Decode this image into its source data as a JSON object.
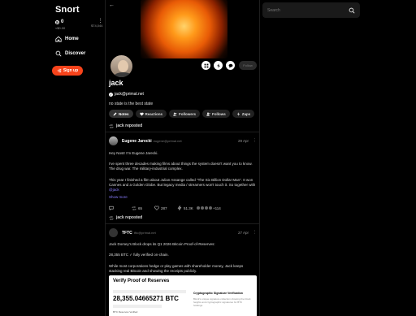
{
  "app": {
    "title": "Snort"
  },
  "sidebar": {
    "balance": {
      "value": "0",
      "sub": "≈$0.00"
    },
    "balance_right": "$74,044",
    "items": [
      {
        "label": "Home",
        "icon": "home-icon"
      },
      {
        "label": "Discover",
        "icon": "search-icon"
      }
    ],
    "signup_label": "Sign up",
    "accent": "#f7431b"
  },
  "profile": {
    "name": "jack",
    "nip05": "jack@primal.net",
    "about": "no state is the best state",
    "follow_label": "Follow",
    "tabs": [
      {
        "label": "Notes",
        "icon": "pencil-icon",
        "active": true
      },
      {
        "label": "Reactions",
        "icon": "heart-icon"
      },
      {
        "label": "Followers",
        "icon": "users-icon"
      },
      {
        "label": "Follows",
        "icon": "user-plus-icon"
      },
      {
        "label": "Zaps",
        "icon": "zap-icon"
      }
    ]
  },
  "feed": [
    {
      "repost_label": "jack reposted",
      "author": "Eugene Jarecki",
      "nip05": "eugene@primal.net",
      "date": "29 Apr",
      "text": [
        "Hey Nostr I'm Eugene Jarecki.",
        "I've spent three decades making films about things the system doesn't want you to know. The drug war. The military-industrial complex.",
        "This year I finished a film about Julian Assange called \"The Six Billion Dollar Man\". It won Cannes and a Golden Globe. But legacy media / streamers won't touch it. So together with"
      ],
      "mention": "@jack",
      "show_more": "Show more",
      "reposts": "65",
      "likes": "287",
      "zaps": "51.3K",
      "zappers_more": "+114"
    },
    {
      "repost_label": "jack reposted",
      "author": "TFTC",
      "nip05": "tftc@primal.net",
      "date": "27 Apr",
      "text": [
        "Jack Dorsey's Block drops its Q1 2026 Bitcoin Proof-of-Reserves:",
        "28,355 BTC ✓ fully verified on-chain.",
        "While most corporations hedge or play games with shareholder money, Jack keeps stacking real Bitcoin and showing the receipts publicly."
      ],
      "embed": {
        "heading": "Verify Proof of Reserves",
        "amount": "28,355.04665271 BTC",
        "right_heading": "Cryptographic Signature Verification",
        "right_text": "Block's unique signature collection showing the block heights and cryptographic signatures for BTC holdings.",
        "label": "BTC Reserves Verified"
      }
    }
  ],
  "search": {
    "placeholder": "Search"
  }
}
